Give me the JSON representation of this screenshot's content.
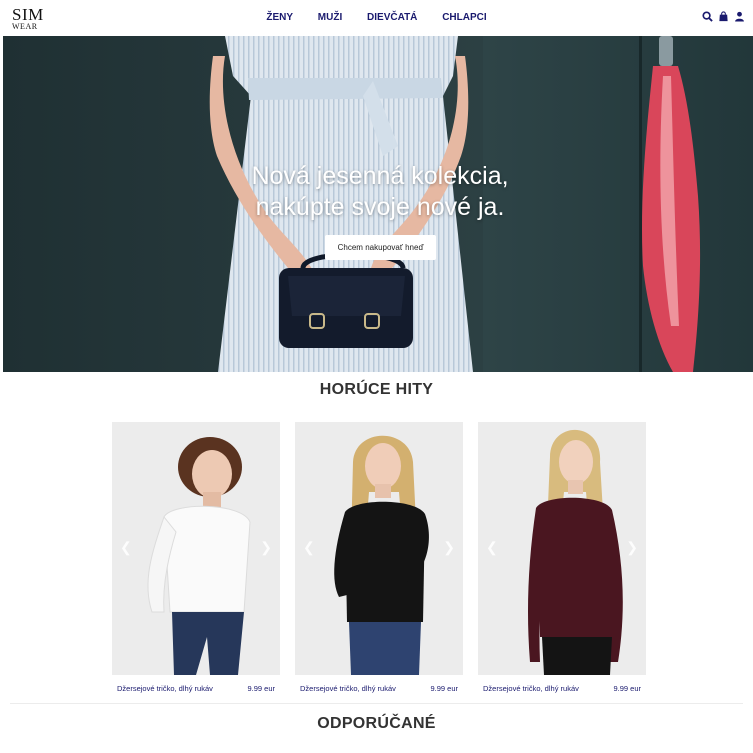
{
  "header": {
    "logo_line1": "SIM",
    "logo_line2": "WEAR",
    "nav": [
      "ŽENY",
      "MUŽI",
      "DIEVČATÁ",
      "CHLAPCI"
    ],
    "icons": [
      "search-icon",
      "shopping-bag-icon",
      "user-icon"
    ],
    "brand_color": "#1a1a6e"
  },
  "hero": {
    "title_line1": "Nová jesenná kolekcia,",
    "title_line2": "nakúpte svoje nové ja.",
    "button_label": "Chcem nakupovať hneď"
  },
  "hot_hits": {
    "title": "HORÚCE HITY",
    "products": [
      {
        "name": "Džersejové tričko, dlhý rukáv",
        "price": "9.99 eur",
        "shirt_color": "#ffffff"
      },
      {
        "name": "Džersejové tričko, dlhý rukáv",
        "price": "9.99 eur",
        "shirt_color": "#151515"
      },
      {
        "name": "Džersejové tričko, dlhý rukáv",
        "price": "9.99 eur",
        "shirt_color": "#4a1620"
      }
    ]
  },
  "recommended": {
    "title": "ODPORÚČANÉ"
  }
}
